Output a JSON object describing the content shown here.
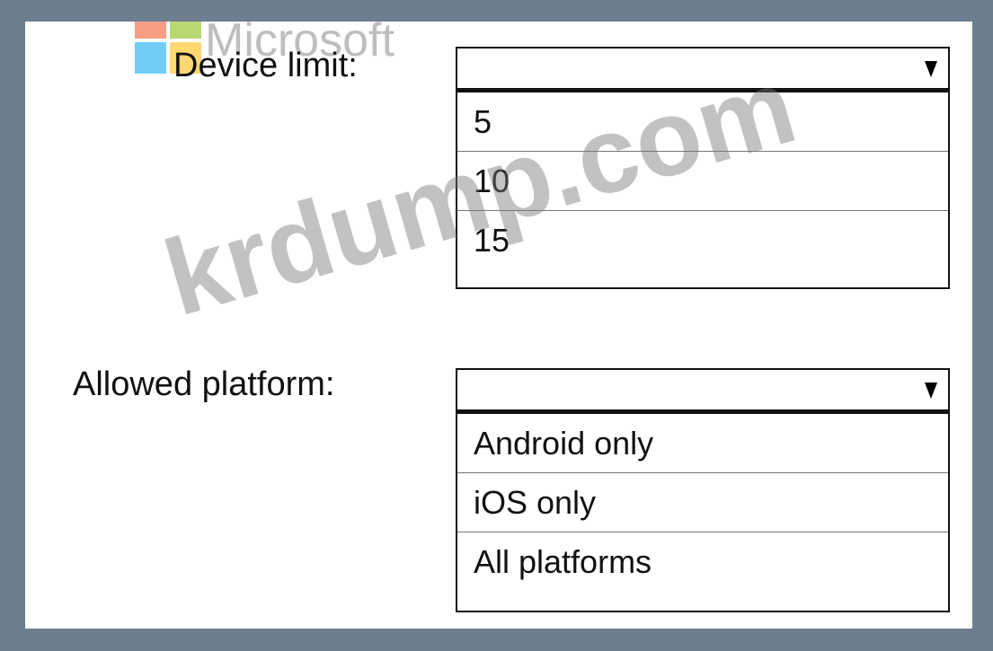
{
  "logo": {
    "text": "Microsoft",
    "colors": [
      "#f25022",
      "#7fba00",
      "#00a4ef",
      "#ffb900"
    ]
  },
  "fields": {
    "device_limit": {
      "label": "Device limit:",
      "selected": "",
      "options": [
        "5",
        "10",
        "15"
      ]
    },
    "allowed_platform": {
      "label": "Allowed platform:",
      "selected": "",
      "options": [
        "Android only",
        "iOS only",
        "All platforms"
      ]
    }
  },
  "watermark": "krdump.com",
  "icons": {
    "dropdown_arrow": "triangle-down-icon"
  }
}
